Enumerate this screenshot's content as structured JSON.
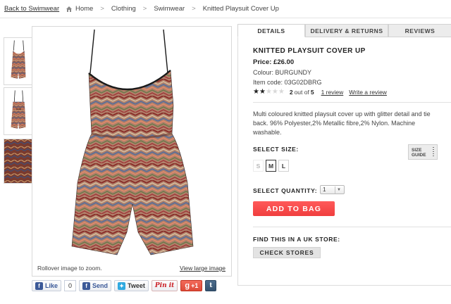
{
  "breadcrumb": {
    "back_label": "Back to Swimwear",
    "items": [
      "Home",
      "Clothing",
      "Swimwear",
      "Knitted Playsuit Cover Up"
    ],
    "separator": ">"
  },
  "gallery": {
    "thumbnails": [
      "playsuit-front-thumb",
      "playsuit-back-thumb",
      "fabric-closeup-thumb"
    ],
    "zoom_hint": "Rollover image to zoom.",
    "view_large_label": "View large image"
  },
  "social": {
    "like_label": "Like",
    "like_count": "0",
    "send_label": "Send",
    "tweet_label": "Tweet",
    "pin_label": "Pin it",
    "gplus_label": "+1",
    "tumblr_label": "t"
  },
  "tabs": [
    {
      "label": "DETAILS",
      "active": true
    },
    {
      "label": "DELIVERY & RETURNS",
      "active": false
    },
    {
      "label": "REVIEWS",
      "active": false
    }
  ],
  "product": {
    "title": "KNITTED PLAYSUIT COVER UP",
    "price": "Price: £26.00",
    "colour": "Colour: BURGUNDY",
    "item_code": "Item code: 03G02DBRG",
    "rating_value": 2,
    "rating_max": 5,
    "rating_num": "2",
    "rating_mid": "out of",
    "rating_den": "5",
    "review_count_label": "1 review",
    "write_review_label": "Write a review",
    "description": "Multi coloured knitted playsuit cover up with glitter detail and tie back. 96% Polyester,2% Metallic fibre,2% Nylon. Machine washable."
  },
  "purchase": {
    "size_label": "SELECT SIZE:",
    "size_guide_line1": "SIZE",
    "size_guide_line2": "GUIDE",
    "sizes": [
      {
        "label": "S",
        "state": "disabled"
      },
      {
        "label": "M",
        "state": "selected"
      },
      {
        "label": "L",
        "state": "available"
      }
    ],
    "quantity_label": "SELECT QUANTITY:",
    "quantity_value": "1",
    "add_to_bag_label": "ADD TO BAG",
    "store_label": "FIND THIS IN A UK STORE:",
    "check_stores_label": "CHECK STORES"
  },
  "colors": {
    "add_to_bag": "#f24646",
    "facebook": "#3b5998",
    "gplus": "#dd4b39"
  }
}
